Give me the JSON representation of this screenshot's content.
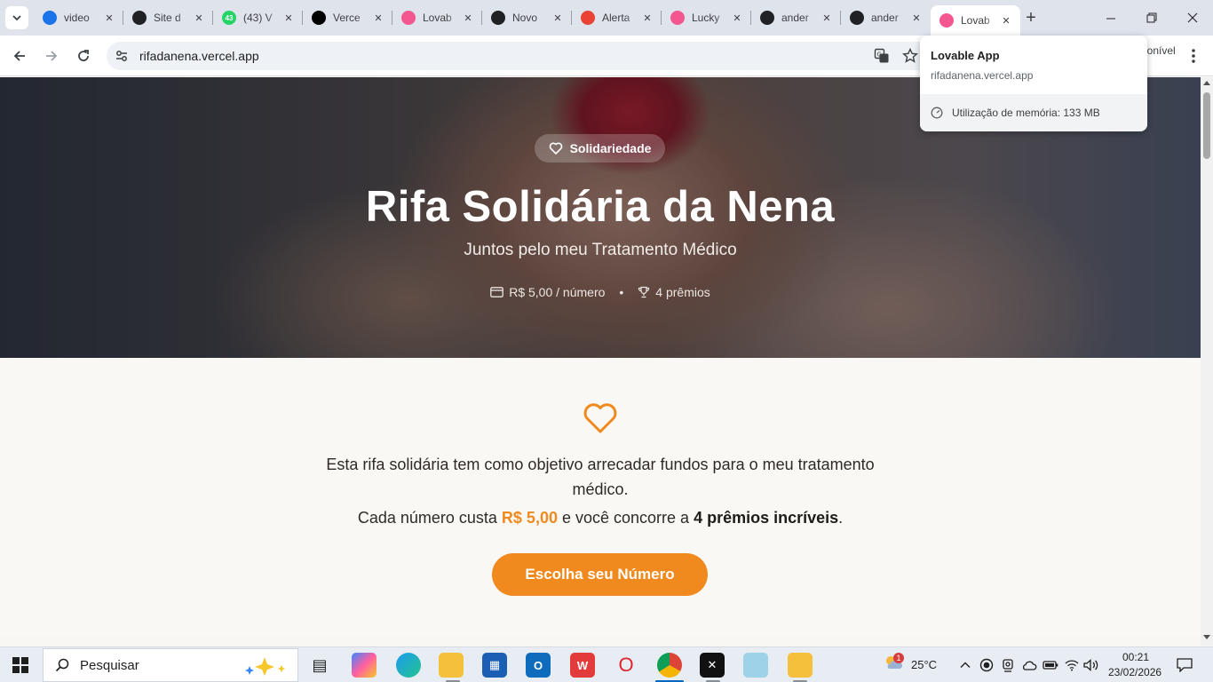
{
  "browser": {
    "tabs": [
      {
        "title": "video",
        "favicon": "google-drive-icon",
        "color": "#1a73e8"
      },
      {
        "title": "Site d",
        "favicon": "chatgpt-icon",
        "color": "#202124"
      },
      {
        "title": "(43) V",
        "favicon": "whatsapp-icon",
        "color": "#25d366",
        "badge": "43"
      },
      {
        "title": "Verce",
        "favicon": "vercel-icon",
        "color": "#000000"
      },
      {
        "title": "Lovab",
        "favicon": "lovable-icon",
        "color": "#f4568f"
      },
      {
        "title": "Novo",
        "favicon": "github-icon",
        "color": "#202124"
      },
      {
        "title": "Alerta",
        "favicon": "gmail-icon",
        "color": "#ea4335"
      },
      {
        "title": "Lucky",
        "favicon": "lovable-icon",
        "color": "#f4568f"
      },
      {
        "title": "ander",
        "favicon": "github-icon",
        "color": "#202124"
      },
      {
        "title": "ander",
        "favicon": "github-icon",
        "color": "#202124"
      },
      {
        "title": "Lovab",
        "favicon": "lovable-icon",
        "color": "#f4568f",
        "active": true
      }
    ],
    "url": "rifadanena.vercel.app",
    "profile_chip": "ponível"
  },
  "hovercard": {
    "title": "Lovable App",
    "domain": "rifadanena.vercel.app",
    "memory": "Utilização de memória: 133 MB"
  },
  "hero": {
    "badge": "Solidariedade",
    "title": "Rifa Solidária da Nena",
    "subtitle": "Juntos pelo meu Tratamento Médico",
    "price": "R$ 5,00 / número",
    "separator": "•",
    "prizes": "4 prêmios"
  },
  "intro": {
    "text": "Esta rifa solidária tem como objetivo arrecadar fundos para o meu tratamento médico.",
    "price_prefix": "Cada número custa ",
    "price_value": "R$ 5,00",
    "price_middle": " e você concorre a ",
    "price_prizes": "4 prêmios incríveis",
    "price_suffix": ".",
    "cta": "Escolha seu Número"
  },
  "colors": {
    "accent": "#f08a1f",
    "hero_overlay": "#1e1a1c"
  },
  "taskbar": {
    "search_label": "Pesquisar",
    "weather_temp": "25°C",
    "weather_badge": "1",
    "time": "00:21",
    "date": "23/02/2026",
    "apps": [
      "task-view-icon",
      "copilot-icon",
      "edge-icon",
      "file-explorer-icon",
      "microsoft-store-icon",
      "outlook-icon",
      "wps-office-icon",
      "opera-icon",
      "chrome-icon",
      "capcut-icon",
      "notepad-icon",
      "folder-app-icon"
    ]
  }
}
